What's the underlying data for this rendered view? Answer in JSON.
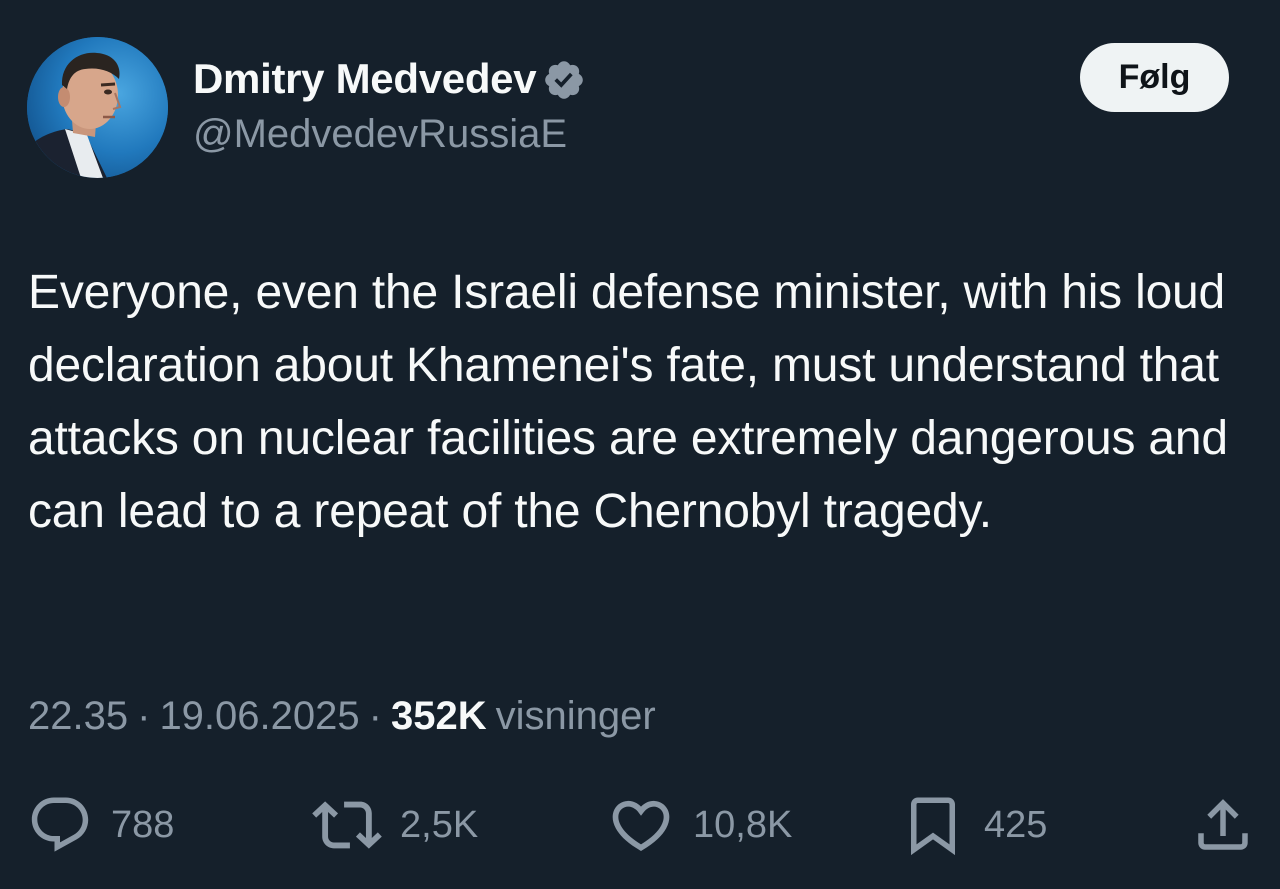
{
  "header": {
    "display_name": "Dmitry Medvedev",
    "handle": "@MedvedevRussiaE",
    "follow_label": "Følg",
    "verified": true
  },
  "tweet": {
    "text": "Everyone, even the Israeli defense minister, with his loud declaration about Khamenei's fate, must understand that attacks on nuclear facilities are extremely dangerous and can lead to a repeat of the Chernobyl tragedy."
  },
  "meta": {
    "time": "22.35",
    "separator": "·",
    "date": "19.06.2025",
    "views_count": "352K",
    "views_label": "visninger"
  },
  "actions": {
    "replies": "788",
    "reposts": "2,5K",
    "likes": "10,8K",
    "bookmarks": "425"
  },
  "colors": {
    "background": "#15202b",
    "primary_text": "#f7f9f9",
    "secondary_text": "#8b98a5",
    "follow_button_bg": "#eff3f4",
    "verified_badge": "#8b98a5"
  },
  "icons": {
    "verified": "verified-badge-icon",
    "reply": "reply-bubble-icon",
    "repost": "repost-arrows-icon",
    "like": "heart-icon",
    "bookmark": "bookmark-icon",
    "share": "share-upload-icon"
  }
}
